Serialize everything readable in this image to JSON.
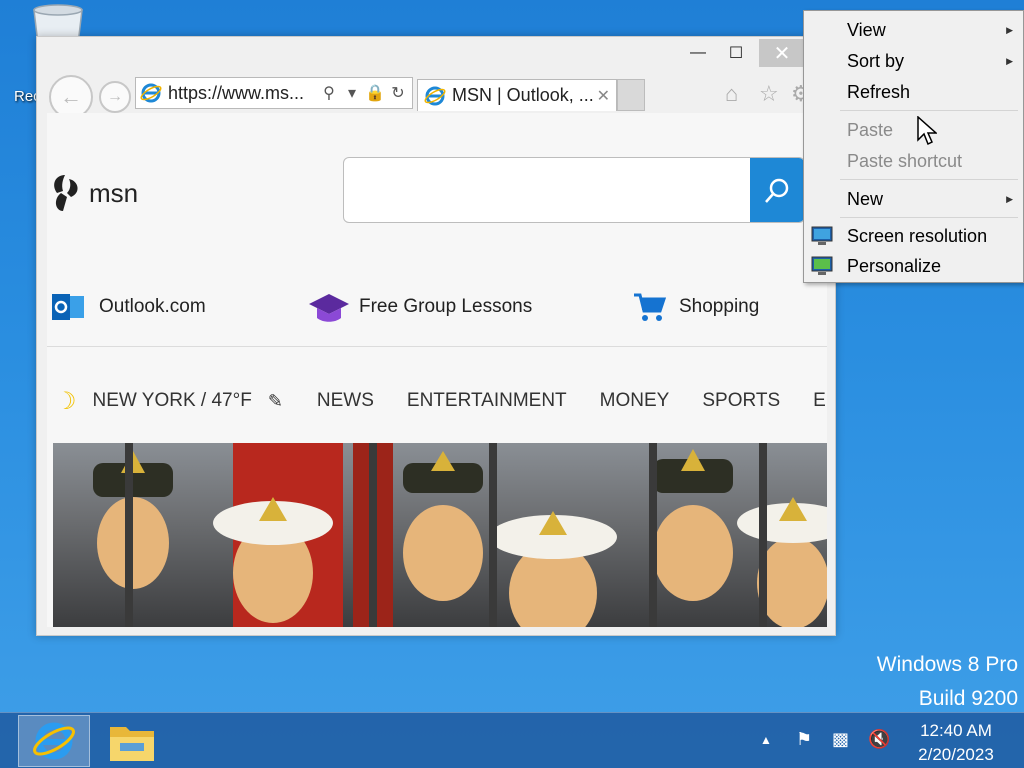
{
  "desktop": {
    "recycle_bin_label": "Rec",
    "watermark_line1": "Windows 8 Pro",
    "watermark_line2": "Build 9200"
  },
  "browser": {
    "address": "https://www.ms...",
    "tab_title": "MSN | Outlook, ...",
    "close_glyph": "✕",
    "min_glyph": "—",
    "max_glyph": "☐"
  },
  "msn": {
    "logo_text": "msn",
    "search_placeholder": "",
    "quick_links": [
      {
        "label": "Outlook.com",
        "icon": "outlook-icon"
      },
      {
        "label": "Free Group Lessons",
        "icon": "graduation-cap-icon"
      },
      {
        "label": "Shopping",
        "icon": "shopping-cart-icon"
      }
    ],
    "weather": "NEW YORK / 47°F",
    "nav_items": [
      "NEWS",
      "ENTERTAINMENT",
      "MONEY",
      "SPORTS",
      "E"
    ]
  },
  "context_menu": {
    "items": [
      {
        "label": "View",
        "submenu": true,
        "enabled": true
      },
      {
        "label": "Sort by",
        "submenu": true,
        "enabled": true
      },
      {
        "label": "Refresh",
        "submenu": false,
        "enabled": true
      },
      {
        "label": "Paste",
        "submenu": false,
        "enabled": false
      },
      {
        "label": "Paste shortcut",
        "submenu": false,
        "enabled": false
      },
      {
        "label": "New",
        "submenu": true,
        "enabled": true
      },
      {
        "label": "Screen resolution",
        "submenu": false,
        "enabled": true,
        "icon": "monitor-icon"
      },
      {
        "label": "Personalize",
        "submenu": false,
        "enabled": true,
        "icon": "personalize-icon"
      }
    ]
  },
  "taskbar": {
    "clock_time": "12:40 AM",
    "clock_date": "2/20/2023"
  },
  "colors": {
    "accent": "#1e88d6",
    "desktop_bg": "#2a8ee0"
  }
}
